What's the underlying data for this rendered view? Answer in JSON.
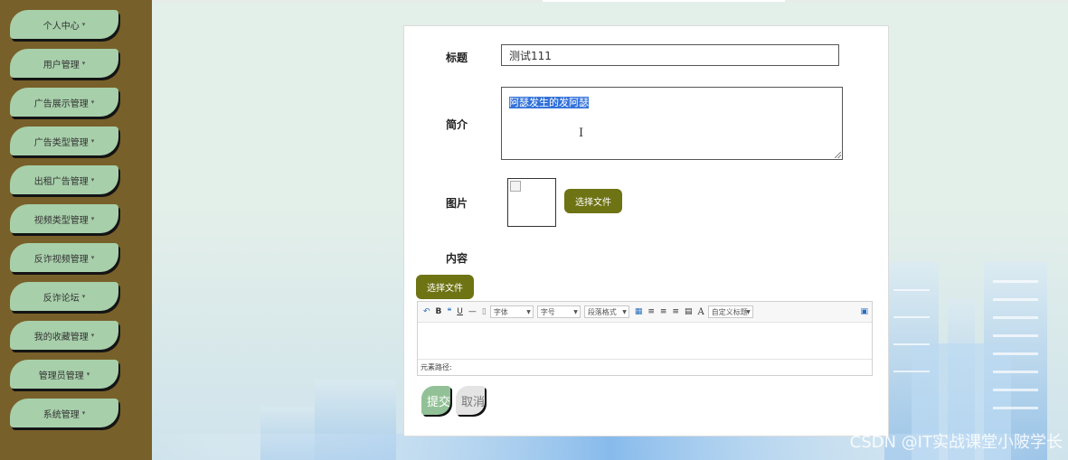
{
  "sidebar": {
    "items": [
      {
        "label": "个人中心"
      },
      {
        "label": "用户管理"
      },
      {
        "label": "广告展示管理"
      },
      {
        "label": "广告类型管理"
      },
      {
        "label": "出租广告管理"
      },
      {
        "label": "视频类型管理"
      },
      {
        "label": "反诈视频管理"
      },
      {
        "label": "反诈论坛"
      },
      {
        "label": "我的收藏管理"
      },
      {
        "label": "管理员管理"
      },
      {
        "label": "系统管理"
      }
    ],
    "caret": "▾"
  },
  "form": {
    "title_label": "标题",
    "title_value": "测试111",
    "intro_label": "简介",
    "intro_value": "阿瑟发生的发阿瑟",
    "image_label": "图片",
    "image_choose_label": "选择文件",
    "content_label": "内容",
    "content_choose_label": "选择文件"
  },
  "editor": {
    "font_label": "字体",
    "size_label": "字号",
    "paragraph_label": "段落格式",
    "custom_title_label": "自定义标题",
    "path_label": "元素路径:"
  },
  "actions": {
    "submit_label": "提交",
    "cancel_label": "取消"
  },
  "watermark": "CSDN @IT实战课堂小陂学长",
  "colors": {
    "sidebar_bg": "#78602a",
    "nav_item_bg": "#a7cfaa",
    "button_olive": "#6e7314",
    "selection": "#3271d9"
  }
}
